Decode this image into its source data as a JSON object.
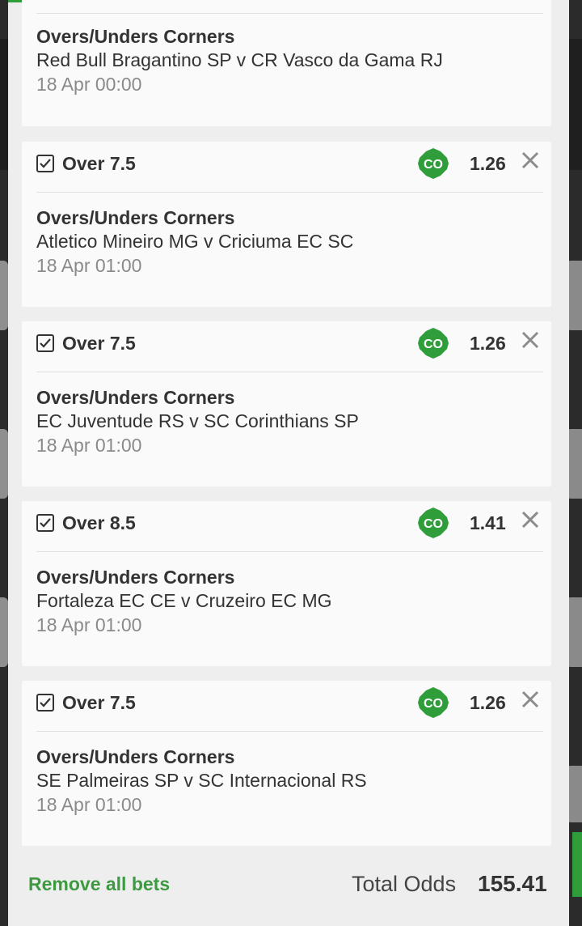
{
  "colors": {
    "accent": "#2e9d3a",
    "remove_all": "#3d9a41",
    "muted": "#8a8a8a"
  },
  "bets": [
    {
      "selection": "",
      "odds": "",
      "market": "Overs/Unders Corners",
      "fixture": "Red Bull Bragantino SP v CR Vasco da Gama RJ",
      "date": "18 Apr 00:00"
    },
    {
      "selection": "Over 7.5",
      "odds": "1.26",
      "badge": "CO",
      "market": "Overs/Unders Corners",
      "fixture": "Atletico Mineiro MG v Criciuma EC SC",
      "date": "18 Apr 01:00"
    },
    {
      "selection": "Over 7.5",
      "odds": "1.26",
      "badge": "CO",
      "market": "Overs/Unders Corners",
      "fixture": "EC Juventude RS v SC Corinthians SP",
      "date": "18 Apr 01:00"
    },
    {
      "selection": "Over 8.5",
      "odds": "1.41",
      "badge": "CO",
      "market": "Overs/Unders Corners",
      "fixture": "Fortaleza EC CE v Cruzeiro EC MG",
      "date": "18 Apr 01:00"
    },
    {
      "selection": "Over 7.5",
      "odds": "1.26",
      "badge": "CO",
      "market": "Overs/Unders Corners",
      "fixture": "SE Palmeiras SP v SC Internacional RS",
      "date": "18 Apr 01:00"
    }
  ],
  "footer": {
    "remove_all_label": "Remove all bets",
    "total_odds_label": "Total Odds",
    "total_odds_value": "155.41"
  }
}
